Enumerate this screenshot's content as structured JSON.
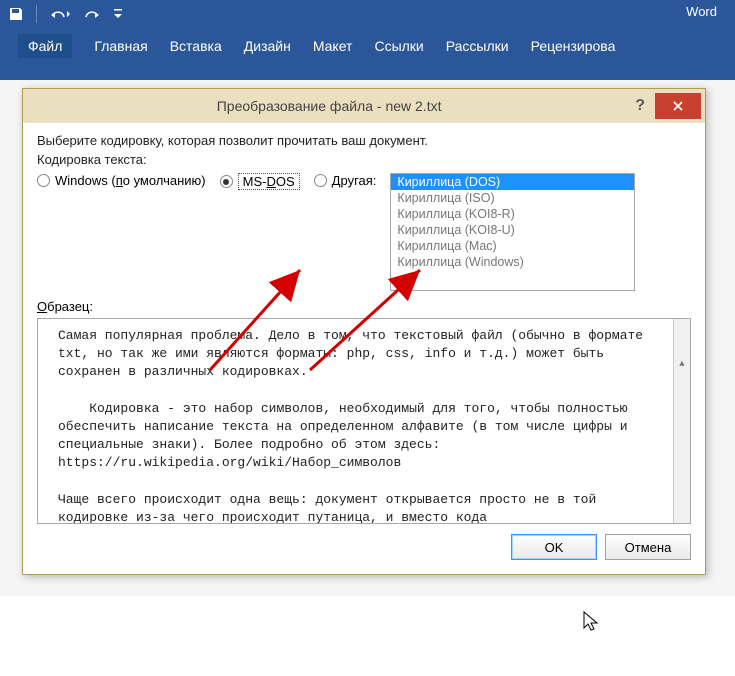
{
  "app": {
    "title": "Word"
  },
  "qat": {
    "save": "save-icon",
    "undo": "undo-icon",
    "redo": "redo-icon"
  },
  "ribbon_tabs": [
    "Файл",
    "Главная",
    "Вставка",
    "Дизайн",
    "Макет",
    "Ссылки",
    "Рассылки",
    "Рецензирова"
  ],
  "dialog": {
    "title": "Преобразование файла - new 2.txt",
    "instruction": "Выберите кодировку, которая позволит прочитать ваш документ.",
    "group_label": "Кодировка текста:",
    "radios": {
      "windows": "Windows (по умолчанию)",
      "msdos": "MS-DOS",
      "other": "Другая:"
    },
    "selected_radio": "msdos",
    "encodings": [
      "Кириллица (DOS)",
      "Кириллица (ISO)",
      "Кириллица (KOI8-R)",
      "Кириллица (KOI8-U)",
      "Кириллица (Mac)",
      "Кириллица (Windows)"
    ],
    "selected_encoding": 0,
    "sample_label": "Образец:",
    "sample_text": "Самая популярная проблема. Дело в том, что текстовый файл (обычно в формате txt, но так же ими являются форматы: php, css, info и т.д.) может быть сохранен в различных кодировках.\n\n    Кодировка - это набор символов, необходимый для того, чтобы полностью обеспечить написание текста на определенном алфавите (в том числе цифры и специальные знаки). Более подробно об этом здесь: https://ru.wikipedia.org/wiki/Набор_символов\n\nЧаще всего происходит одна вещь: документ открывается просто не в той кодировке из-за чего происходит путаница, и вместо кода",
    "buttons": {
      "ok": "OK",
      "cancel": "Отмена"
    }
  }
}
